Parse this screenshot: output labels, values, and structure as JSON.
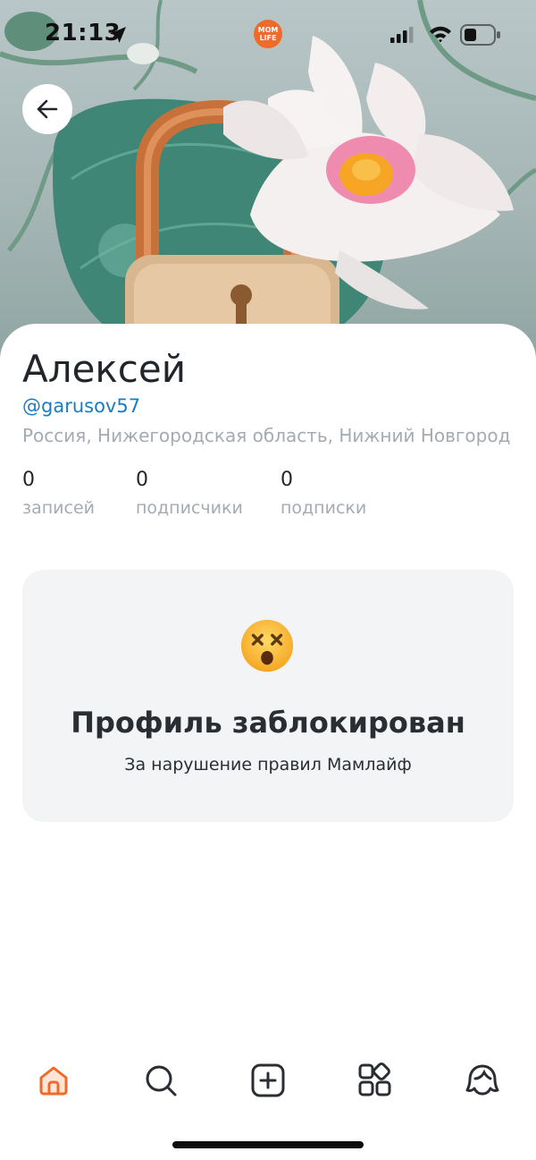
{
  "status_bar": {
    "time": "21:13",
    "app_badge": "MOM\nLIFE",
    "icons": [
      "location-arrow-icon",
      "signal-icon",
      "wifi-icon",
      "battery-icon"
    ]
  },
  "header": {
    "back_icon": "arrow-left-icon"
  },
  "profile": {
    "name": "Алексей",
    "handle": "@garusov57",
    "location": "Россия, Нижегородская область, Нижний Новгород"
  },
  "stats": [
    {
      "value": "0",
      "label": "записей"
    },
    {
      "value": "0",
      "label": "подписчики"
    },
    {
      "value": "0",
      "label": "подписки"
    }
  ],
  "blocked": {
    "emoji": "dizzy-face-emoji",
    "title": "Профиль заблокирован",
    "subtitle": "За нарушение правил Мамлайф"
  },
  "tabbar": {
    "items": [
      "home-icon",
      "search-icon",
      "add-post-icon",
      "catalog-icon",
      "profile-icon"
    ],
    "active": "home-icon"
  },
  "colors": {
    "accent": "#f06a2a",
    "link": "#1c7bc2",
    "muted_text": "#a5abb3",
    "card_background": "#f3f4f6",
    "icon_default": "#2a2e33"
  }
}
